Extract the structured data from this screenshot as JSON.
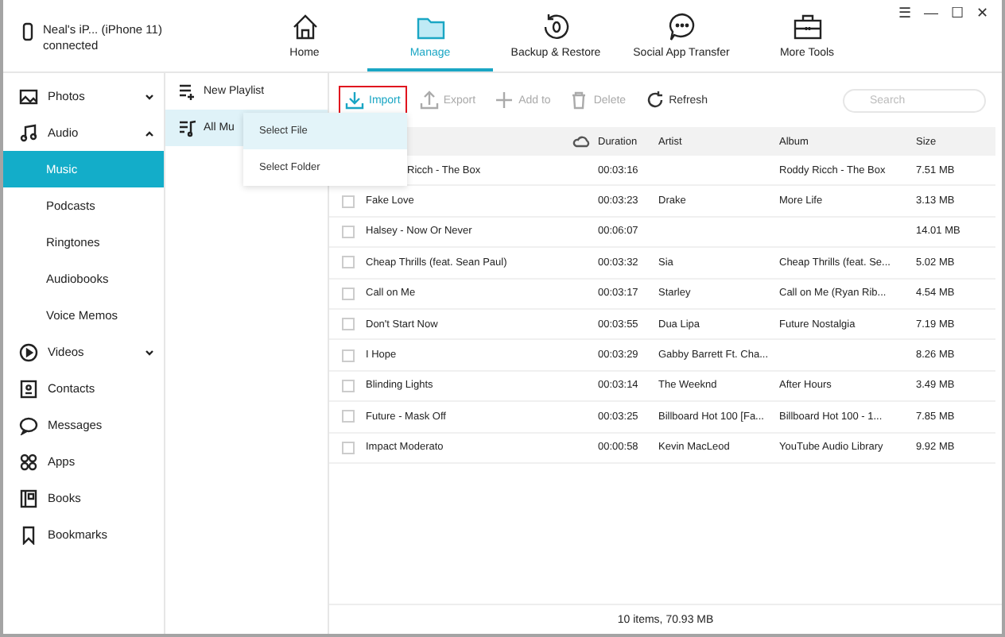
{
  "device": {
    "name": "Neal's iP... (iPhone 11)",
    "status": "connected"
  },
  "window_controls": [
    "☰",
    "—",
    "☐",
    "✕"
  ],
  "tabs": [
    {
      "label": "Home",
      "selected": false
    },
    {
      "label": "Manage",
      "selected": true
    },
    {
      "label": "Backup & Restore",
      "selected": false
    },
    {
      "label": "Social App Transfer",
      "selected": false
    },
    {
      "label": "More Tools",
      "selected": false
    }
  ],
  "sidebar": {
    "items": [
      {
        "label": "Photos",
        "expanded": false,
        "selected": false
      },
      {
        "label": "Audio",
        "expanded": true,
        "selected": false,
        "children": [
          {
            "label": "Music",
            "selected": true
          },
          {
            "label": "Podcasts",
            "selected": false
          },
          {
            "label": "Ringtones",
            "selected": false
          },
          {
            "label": "Audiobooks",
            "selected": false
          },
          {
            "label": "Voice Memos",
            "selected": false
          }
        ]
      },
      {
        "label": "Videos",
        "expanded": false,
        "selected": false
      },
      {
        "label": "Contacts",
        "selected": false
      },
      {
        "label": "Messages",
        "selected": false
      },
      {
        "label": "Apps",
        "selected": false
      },
      {
        "label": "Books",
        "selected": false
      },
      {
        "label": "Bookmarks",
        "selected": false
      }
    ]
  },
  "playlists": [
    {
      "label": "New Playlist",
      "selected": false
    },
    {
      "label": "All Mu",
      "selected": true
    }
  ],
  "import_menu": [
    {
      "label": "Select File",
      "selected": true
    },
    {
      "label": "Select Folder",
      "selected": false
    }
  ],
  "toolbar": [
    {
      "label": "Import",
      "disabled": false,
      "marked": true
    },
    {
      "label": "Export",
      "disabled": true,
      "marked": false
    },
    {
      "label": "Add to",
      "disabled": true,
      "marked": false
    },
    {
      "label": "Delete",
      "disabled": true,
      "marked": false
    },
    {
      "label": "Refresh",
      "disabled": false,
      "marked": false
    }
  ],
  "search": {
    "placeholder": "Search"
  },
  "table": {
    "columns": [
      "Duration",
      "Artist",
      "Album",
      "Size"
    ],
    "rows": [
      {
        "title": "Ricch - The Box",
        "duration": "00:03:16",
        "artist": "",
        "album": "Roddy Ricch - The Box",
        "size": "7.51 MB"
      },
      {
        "title": "Fake Love",
        "checked": false,
        "duration": "00:03:23",
        "artist": "Drake",
        "album": "More Life",
        "size": "3.13 MB"
      },
      {
        "title": "Halsey - Now Or Never",
        "checked": false,
        "duration": "00:06:07",
        "artist": "",
        "album": "",
        "size": "14.01 MB"
      },
      {
        "title": "Cheap Thrills (feat. Sean Paul)",
        "checked": false,
        "duration": "00:03:32",
        "artist": "Sia",
        "album": "Cheap Thrills (feat. Se...",
        "size": "5.02 MB"
      },
      {
        "title": "Call on Me",
        "checked": false,
        "duration": "00:03:17",
        "artist": "Starley",
        "album": "Call on Me (Ryan Rib...",
        "size": "4.54 MB"
      },
      {
        "title": "Don't Start Now",
        "checked": false,
        "duration": "00:03:55",
        "artist": "Dua Lipa",
        "album": "Future Nostalgia",
        "size": "7.19 MB"
      },
      {
        "title": "I Hope",
        "checked": false,
        "duration": "00:03:29",
        "artist": "Gabby Barrett Ft. Cha...",
        "album": "",
        "size": "8.26 MB"
      },
      {
        "title": "Blinding Lights",
        "checked": false,
        "duration": "00:03:14",
        "artist": "The Weeknd",
        "album": "After Hours",
        "size": "3.49 MB"
      },
      {
        "title": "Future - Mask Off",
        "checked": false,
        "duration": "00:03:25",
        "artist": "Billboard Hot 100 [Fa...",
        "album": "Billboard Hot 100  - 1...",
        "size": "7.85 MB"
      },
      {
        "title": "Impact Moderato",
        "checked": false,
        "duration": "00:00:58",
        "artist": "Kevin MacLeod",
        "album": "YouTube Audio Library",
        "size": "9.92 MB"
      }
    ]
  },
  "status_bar": "10 items, 70.93 MB"
}
